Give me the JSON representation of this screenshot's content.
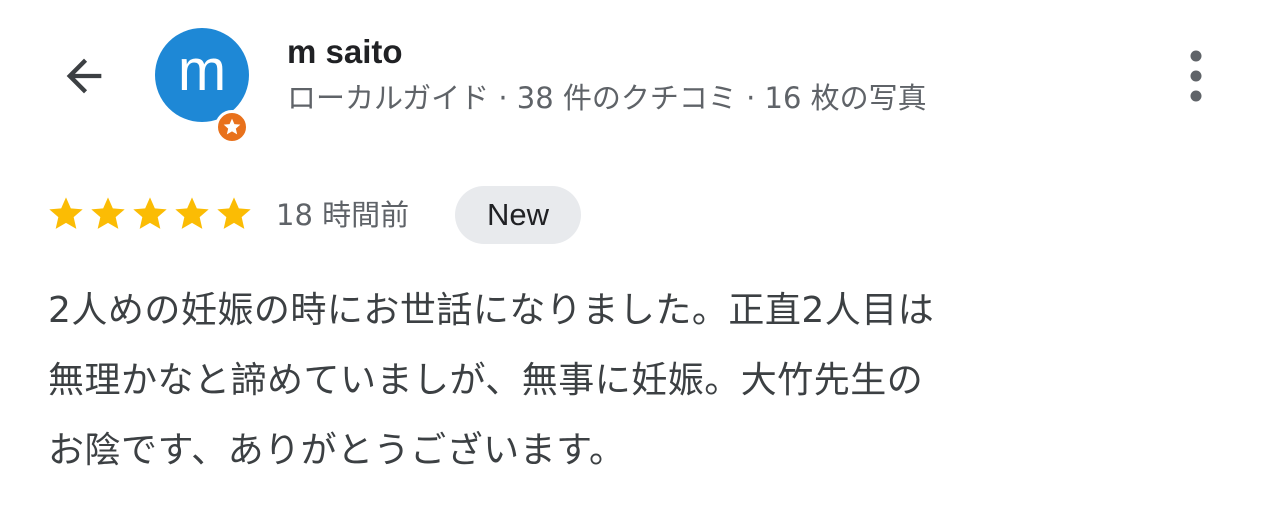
{
  "header": {
    "back_icon": "arrow-back-icon",
    "more_icon": "more-vert-icon"
  },
  "reviewer": {
    "avatar_letter": "m",
    "avatar_color": "#1e88d6",
    "badge_icon": "local-guide-star-icon",
    "badge_color": "#e8711c",
    "name": "m saito",
    "meta": "ローカルガイド · 38 件のクチコミ · 16 枚の写真"
  },
  "review": {
    "rating": 5,
    "rating_max": 5,
    "star_color": "#fbbc04",
    "time": "18 時間前",
    "badge": "New",
    "text_lines": [
      "2人めの妊娠の時にお世話になりました。正直2人目は",
      "無理かなと諦めていましが、無事に妊娠。大竹先生の",
      "お陰です、ありがとうございます。"
    ]
  }
}
